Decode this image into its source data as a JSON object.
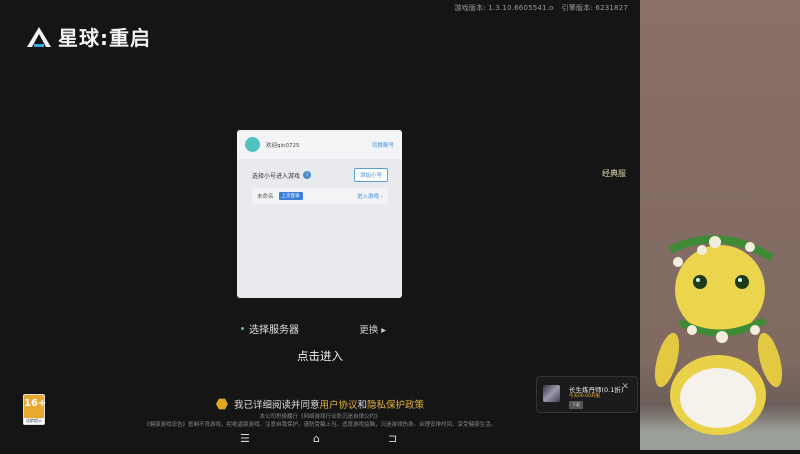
{
  "header": {
    "version_label": "游戏版本: 1.3.10.6605541.o",
    "engine_label": "引擎版本: 6231827",
    "logo_text": "星球:重启"
  },
  "side_tab": {
    "classic": "经典服"
  },
  "login_card": {
    "welcome": "欢迎qin0725",
    "switch_account": "切换账号",
    "pick_label": "选择小号进入游戏",
    "info_icon": "i",
    "add_button": "添加小号",
    "account_name": "未命名",
    "last_used_badge": "上次登录",
    "enter_game": "进入游戏 ›"
  },
  "server": {
    "label": "选择服务器",
    "change": "更换 ▸"
  },
  "enter_label": "点击进入",
  "agreement": {
    "prefix": "我已详细阅读并同意",
    "user_agreement": "用户协议",
    "and": "和",
    "privacy": "隐私保护政策"
  },
  "legal": {
    "line1": "本公司积极履行《网络游戏行业防沉迷自律公约》",
    "line2": "《健康游戏忠告》抵制不良游戏，拒绝盗版游戏。注意自我保护，谨防受骗上当。适度游戏益脑，沉迷游戏伤身。合理安排时间，享受健康生活。"
  },
  "age_rating": {
    "age": "16+",
    "label": "适龄提示"
  },
  "nav": {
    "menu": "☰",
    "home": "⌂",
    "back": "⊐"
  },
  "toast": {
    "title": "长生炼丹师(0.1折)",
    "subtitle": "今天00:00开服",
    "tag": "下载",
    "close": "✕"
  }
}
